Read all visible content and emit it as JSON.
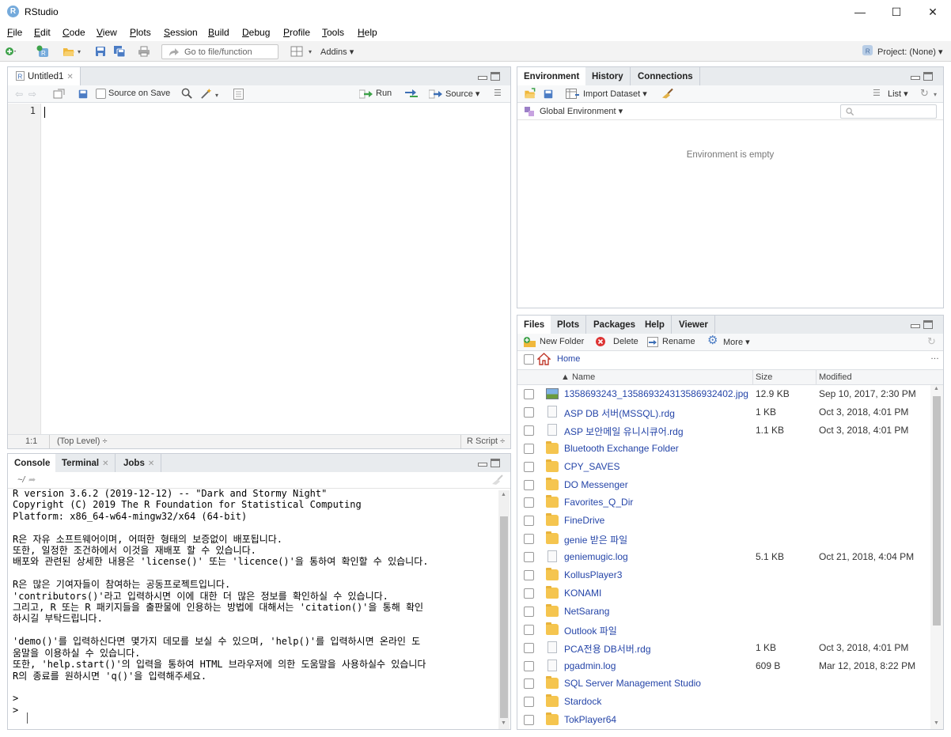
{
  "window": {
    "title": "RStudio",
    "logo_letter": "R",
    "min": "—",
    "max": "☐",
    "close": "✕"
  },
  "menu": [
    "File",
    "Edit",
    "Code",
    "View",
    "Plots",
    "Session",
    "Build",
    "Debug",
    "Profile",
    "Tools",
    "Help"
  ],
  "toolbar": {
    "goto_placeholder": "Go to file/function",
    "addins": "Addins ▾",
    "project": "Project: (None) ▾"
  },
  "source_pane": {
    "tab": "Untitled1",
    "source_on_save": "Source on Save",
    "run": "Run",
    "source": "Source ▾",
    "line_numbers": [
      "1"
    ],
    "status_pos": "1:1",
    "status_scope": "(Top Level) ÷",
    "status_type": "R Script ÷"
  },
  "console_pane": {
    "tabs": [
      "Console",
      "Terminal",
      "Jobs"
    ],
    "path": "~/",
    "text": "R version 3.6.2 (2019-12-12) -- \"Dark and Stormy Night\"\nCopyright (C) 2019 The R Foundation for Statistical Computing\nPlatform: x86_64-w64-mingw32/x64 (64-bit)\n\nR은 자유 소프트웨어이며, 어떠한 형태의 보증없이 배포됩니다.\n또한, 일정한 조건하에서 이것을 재배포 할 수 있습니다.\n배포와 관련된 상세한 내용은 'license()' 또는 'licence()'을 통하여 확인할 수 있습니다.\n\nR은 많은 기여자들이 참여하는 공동프로젝트입니다.\n'contributors()'라고 입력하시면 이에 대한 더 많은 정보를 확인하실 수 있습니다.\n그리고, R 또는 R 패키지들을 출판물에 인용하는 방법에 대해서는 'citation()'을 통해 확인\n하시길 부탁드립니다.\n\n'demo()'를 입력하신다면 몇가지 데모를 보실 수 있으며, 'help()'를 입력하시면 온라인 도\n움말을 이용하실 수 있습니다.\n또한, 'help.start()'의 입력을 통하여 HTML 브라우저에 의한 도움말을 사용하실수 있습니다\nR의 종료를 원하시면 'q()'을 입력해주세요.\n\n> \n> "
  },
  "env_pane": {
    "tabs": [
      "Environment",
      "History",
      "Connections"
    ],
    "import_dataset": "Import Dataset ▾",
    "list_mode": "List ▾",
    "global_env": "Global Environment ▾",
    "empty_msg": "Environment is empty"
  },
  "files_pane": {
    "tabs": [
      "Files",
      "Plots",
      "Packages",
      "Help",
      "Viewer"
    ],
    "new_folder": "New Folder",
    "delete": "Delete",
    "rename": "Rename",
    "more": "More ▾",
    "breadcrumb": "Home",
    "ellipsis": "…",
    "columns": {
      "name": "▲ Name",
      "size": "Size",
      "modified": "Modified"
    },
    "rows": [
      {
        "icon": "image",
        "name": "1358693243_13586932431358693240​2.jpg",
        "size": "12.9 KB",
        "modified": "Sep 10, 2017, 2:30 PM"
      },
      {
        "icon": "doc",
        "name": "ASP DB 서버(MSSQL).rdg",
        "size": "1 KB",
        "modified": "Oct 3, 2018, 4:01 PM"
      },
      {
        "icon": "doc",
        "name": "ASP 보안메일 유니시큐어.rdg",
        "size": "1.1 KB",
        "modified": "Oct 3, 2018, 4:01 PM"
      },
      {
        "icon": "folder",
        "name": "Bluetooth Exchange Folder",
        "size": "",
        "modified": ""
      },
      {
        "icon": "folder",
        "name": "CPY_SAVES",
        "size": "",
        "modified": ""
      },
      {
        "icon": "folder",
        "name": "DO Messenger",
        "size": "",
        "modified": ""
      },
      {
        "icon": "folder",
        "name": "Favorites_Q_Dir",
        "size": "",
        "modified": ""
      },
      {
        "icon": "folder",
        "name": "FineDrive",
        "size": "",
        "modified": ""
      },
      {
        "icon": "folder",
        "name": "genie 받은 파일",
        "size": "",
        "modified": ""
      },
      {
        "icon": "doc",
        "name": "geniemugic.log",
        "size": "5.1 KB",
        "modified": "Oct 21, 2018, 4:04 PM"
      },
      {
        "icon": "folder",
        "name": "KollusPlayer3",
        "size": "",
        "modified": ""
      },
      {
        "icon": "folder",
        "name": "KONAMI",
        "size": "",
        "modified": ""
      },
      {
        "icon": "folder",
        "name": "NetSarang",
        "size": "",
        "modified": ""
      },
      {
        "icon": "folder",
        "name": "Outlook 파일",
        "size": "",
        "modified": ""
      },
      {
        "icon": "doc",
        "name": "PCA전용 DB서버.rdg",
        "size": "1 KB",
        "modified": "Oct 3, 2018, 4:01 PM"
      },
      {
        "icon": "doc",
        "name": "pgadmin.log",
        "size": "609 B",
        "modified": "Mar 12, 2018, 8:22 PM"
      },
      {
        "icon": "folder",
        "name": "SQL Server Management Studio",
        "size": "",
        "modified": ""
      },
      {
        "icon": "folder",
        "name": "Stardock",
        "size": "",
        "modified": ""
      },
      {
        "icon": "folder",
        "name": "TokPlayer64",
        "size": "",
        "modified": ""
      }
    ]
  }
}
